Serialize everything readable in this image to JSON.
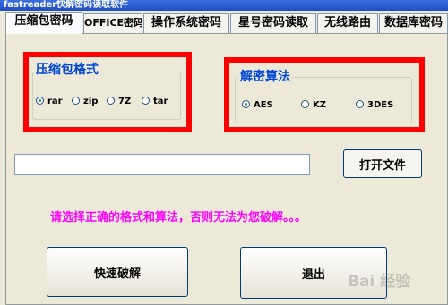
{
  "window": {
    "title": "fastreader快解密码读取软件"
  },
  "tabs": [
    {
      "label": "压缩包密码",
      "active": true
    },
    {
      "label": "OFFICE密码"
    },
    {
      "label": "操作系统密码"
    },
    {
      "label": "星号密码读取"
    },
    {
      "label": "无线路由"
    },
    {
      "label": "数据库密码"
    }
  ],
  "format_group": {
    "title": "压缩包格式",
    "options": [
      {
        "label": "rar",
        "selected": true
      },
      {
        "label": "zip"
      },
      {
        "label": "7Z"
      },
      {
        "label": "tar"
      }
    ]
  },
  "algo_group": {
    "title": "解密算法",
    "options": [
      {
        "label": "AES",
        "selected": true
      },
      {
        "label": "KZ"
      },
      {
        "label": "3DES"
      }
    ]
  },
  "file_input": {
    "value": ""
  },
  "buttons": {
    "open_file": "打开文件",
    "quick_crack": "快速破解",
    "exit": "退出"
  },
  "message": "请选择正确的格式和算法，否则无法为您破解。。。",
  "watermark": "Bai 经验",
  "colors": {
    "highlight_border": "#ff0000",
    "message": "#ff00ff",
    "group_title": "#0046d5"
  }
}
